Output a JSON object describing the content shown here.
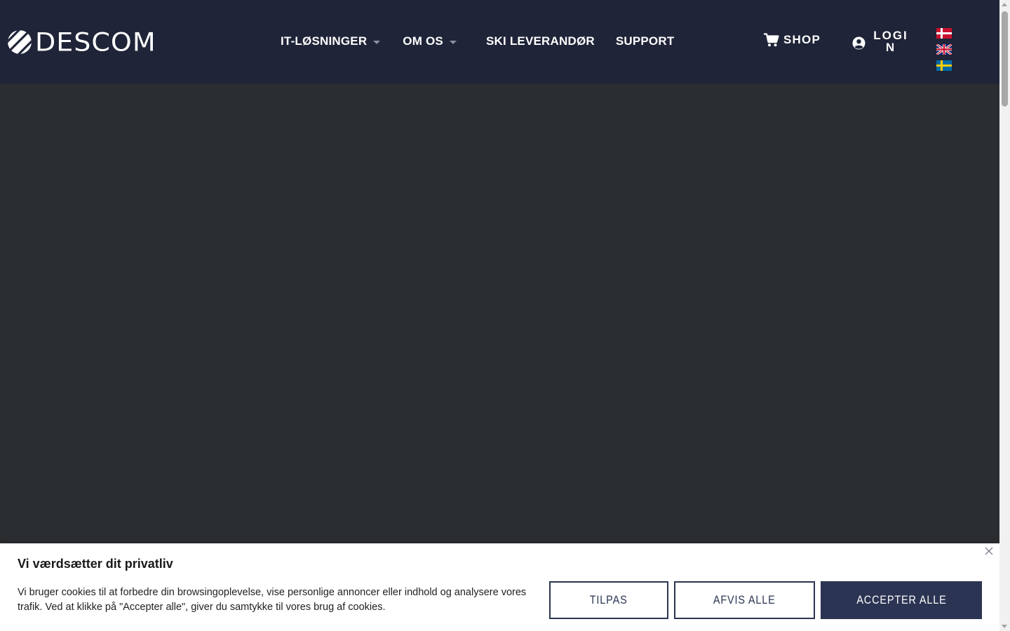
{
  "brand": {
    "logo_text": "DESCOM",
    "header_bg": "#1f2438",
    "hero_bg": "#2b2e31",
    "accent": "#2b3452"
  },
  "nav": {
    "items": [
      {
        "label": "IT-LØSNINGER",
        "has_dropdown": true
      },
      {
        "label": "OM OS",
        "has_dropdown": true
      },
      {
        "label": "SKI LEVERANDØR",
        "has_dropdown": false
      },
      {
        "label": "SUPPORT",
        "has_dropdown": false
      }
    ]
  },
  "header_actions": {
    "shop_label": "SHOP",
    "shop_icon": "cart-icon",
    "login_label": "LOGIN",
    "login_icon": "user-circle-icon"
  },
  "languages": [
    {
      "code": "da",
      "icon": "danish-flag-icon"
    },
    {
      "code": "en",
      "icon": "uk-flag-icon"
    },
    {
      "code": "sv",
      "icon": "swedish-flag-icon"
    }
  ],
  "cookie_banner": {
    "title": "Vi værdsætter dit privatliv",
    "text": "Vi bruger cookies til at forbedre din browsingoplevelse, vise personlige annoncer eller indhold og analysere vores trafik. Ved at klikke på \"Accepter alle\", giver du samtykke til vores brug af cookies.",
    "customize_label": "Tilpas",
    "reject_label": "Afvis alle",
    "accept_label": "Accepter alle",
    "close_icon": "close-icon"
  }
}
